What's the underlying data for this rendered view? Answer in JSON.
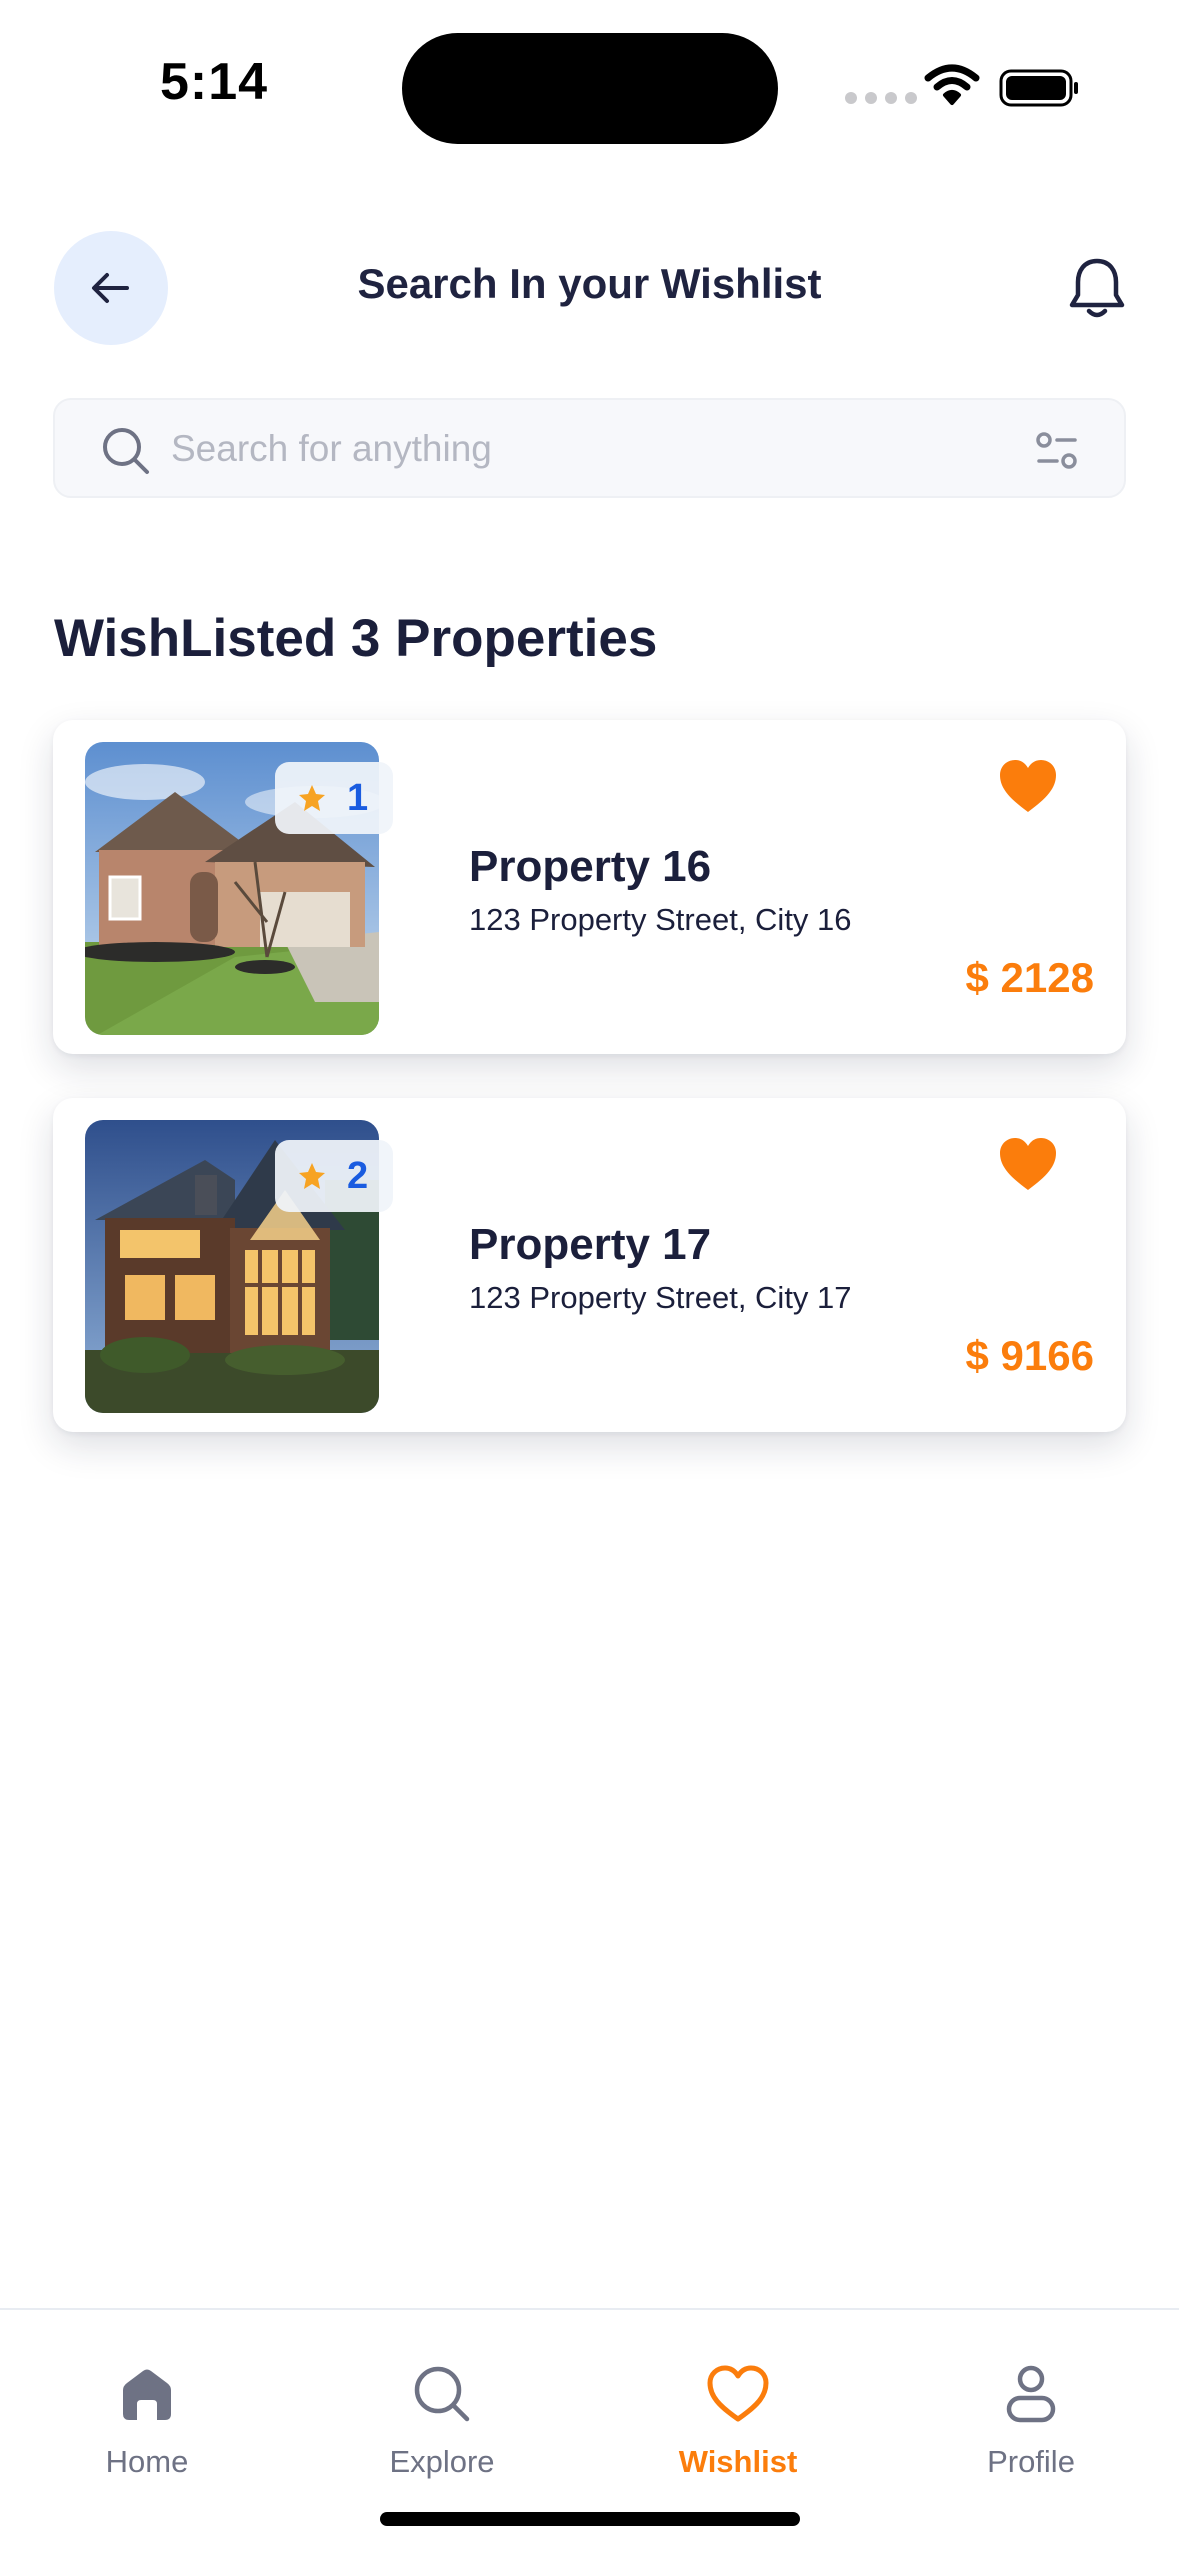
{
  "status_bar": {
    "time": "5:14"
  },
  "header": {
    "title": "Search In your Wishlist",
    "back_icon": "arrow-left-icon",
    "notification_icon": "bell-icon"
  },
  "search": {
    "placeholder": "Search for anything",
    "value": "",
    "search_icon": "search-icon",
    "filter_icon": "filter-sliders-icon"
  },
  "section": {
    "title": "WishListed 3 Properties"
  },
  "properties": [
    {
      "rating": "1",
      "name": "Property 16",
      "address": "123 Property Street, City 16",
      "price": "$ 2128",
      "favorited": true
    },
    {
      "rating": "2",
      "name": "Property 17",
      "address": "123 Property Street, City 17",
      "price": "$ 9166",
      "favorited": true
    }
  ],
  "tabbar": {
    "items": [
      {
        "label": "Home",
        "icon": "home-icon",
        "active": false
      },
      {
        "label": "Explore",
        "icon": "search-icon",
        "active": false
      },
      {
        "label": "Wishlist",
        "icon": "heart-icon",
        "active": true
      },
      {
        "label": "Profile",
        "icon": "user-icon",
        "active": false
      }
    ]
  },
  "colors": {
    "accent": "#fb7d0c",
    "rating_text": "#1a5ce0",
    "text_primary": "#1b1f3b",
    "back_button_bg": "#e5eefd"
  }
}
